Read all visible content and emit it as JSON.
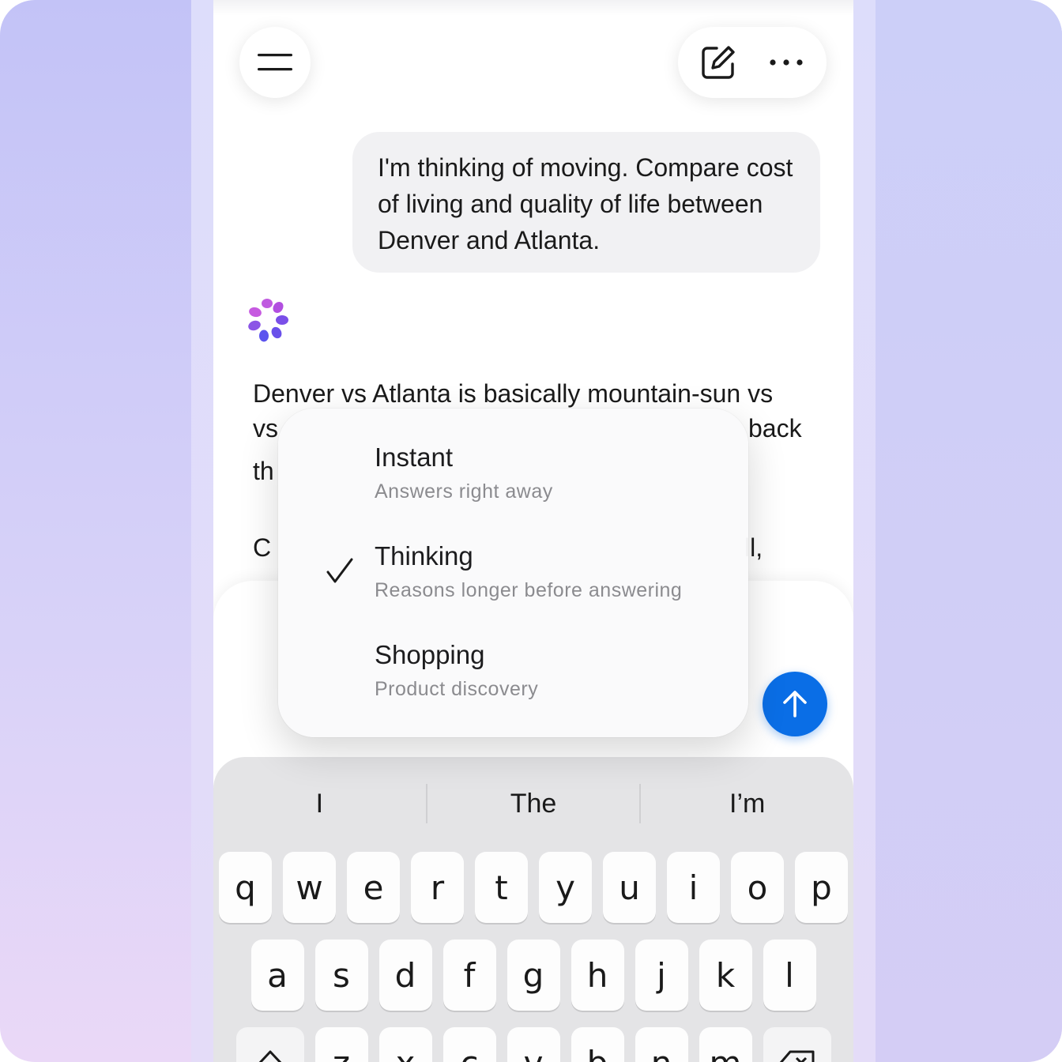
{
  "header": {
    "menu_icon": "hamburger-menu-icon",
    "new_chat_icon": "compose-icon",
    "more_icon": "more-horizontal-icon"
  },
  "conversation": {
    "user_message": "I'm thinking of moving. Compare cost of living and quality of life between Denver and Atlanta.",
    "assistant_paragraphs": [
      "Denver vs Atlanta is basically mountain-sun vs",
      "back",
      "th",
      "C",
      "ll,"
    ]
  },
  "mode_menu": {
    "options": [
      {
        "label": "Instant",
        "description": "Answers right away",
        "selected": false
      },
      {
        "label": "Thinking",
        "description": "Reasons longer before answering",
        "selected": true
      },
      {
        "label": "Shopping",
        "description": "Product discovery",
        "selected": false
      }
    ]
  },
  "composer": {
    "send_icon": "arrow-up-icon",
    "send_color": "#0a6ee6"
  },
  "keyboard": {
    "suggestions": [
      "I",
      "The",
      "I’m"
    ],
    "row1": [
      "q",
      "w",
      "e",
      "r",
      "t",
      "y",
      "u",
      "i",
      "o",
      "p"
    ],
    "row2": [
      "a",
      "s",
      "d",
      "f",
      "g",
      "h",
      "j",
      "k",
      "l"
    ],
    "row3": [
      "z",
      "x",
      "c",
      "v",
      "b",
      "n",
      "m"
    ],
    "shift_icon": "shift-icon",
    "delete_icon": "backspace-icon"
  }
}
